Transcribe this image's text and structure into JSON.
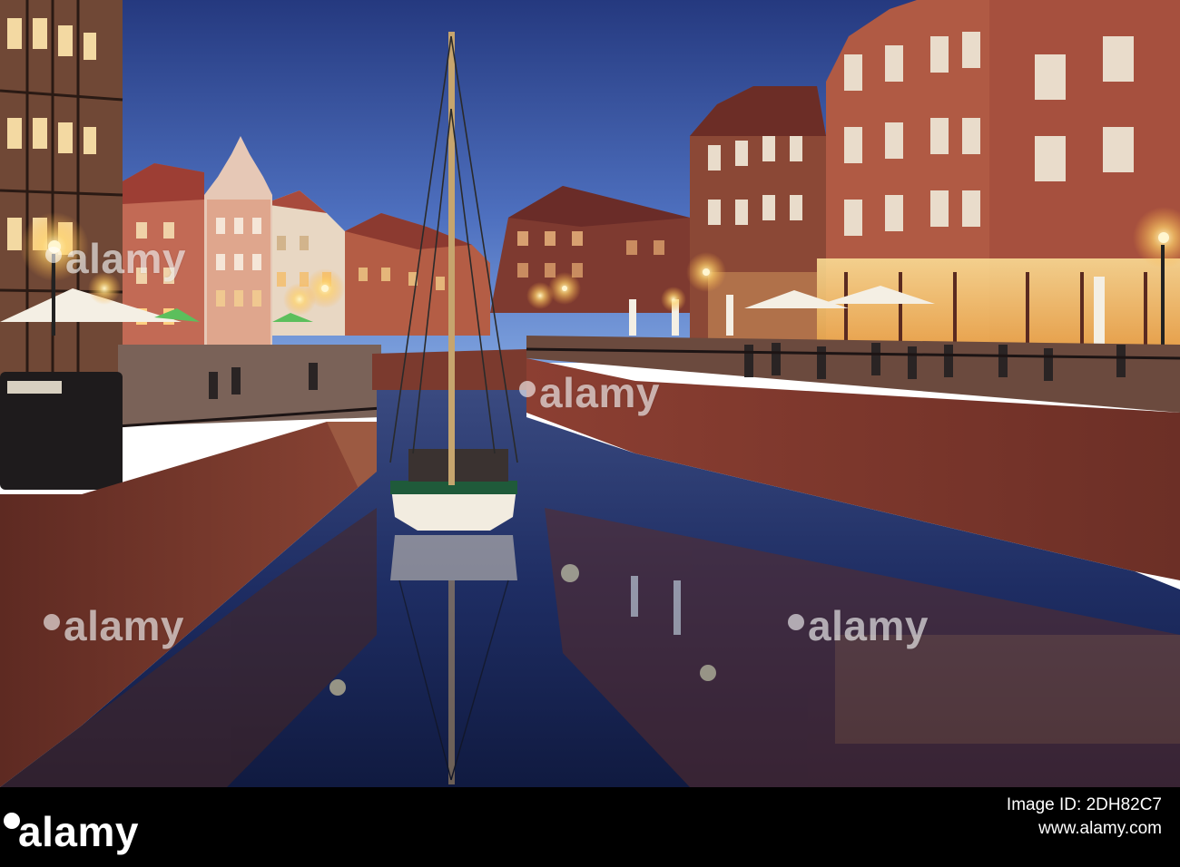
{
  "watermark": {
    "text": "alamy",
    "color": "#ffffff"
  },
  "footer": {
    "brand": "alamy",
    "image_id_label": "Image ID: 2DH82C7",
    "url": "www.alamy.com",
    "background": "#000000"
  },
  "palette": {
    "sky_top": "#2a3f86",
    "sky_bottom": "#6d93d6",
    "brick": "#9a4a3a",
    "water": "#1c2a5a",
    "lamp": "#ffe9a6"
  }
}
